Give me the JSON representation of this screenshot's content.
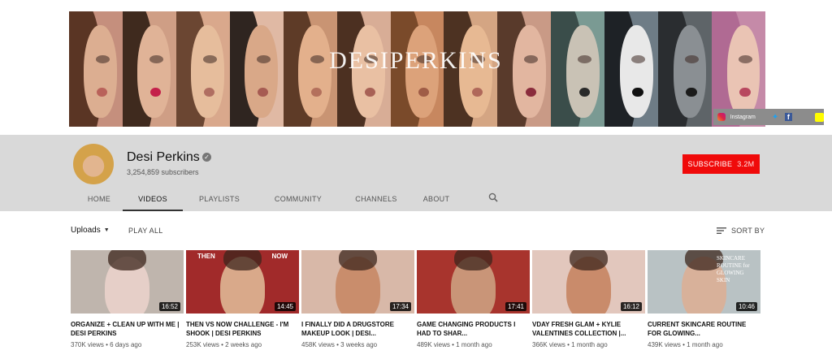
{
  "banner": {
    "title": "DESIPERKINS",
    "social": {
      "instagram_label": "Instagram"
    },
    "panel_colors": [
      {
        "bg": "#c58f7d",
        "hair": "#5a3524",
        "face": "#dcae91",
        "lips": "#b9625a"
      },
      {
        "bg": "#cf9e85",
        "hair": "#3f2a1e",
        "face": "#e0b397",
        "lips": "#c4204a"
      },
      {
        "bg": "#d9a88c",
        "hair": "#6b4632",
        "face": "#e6bd9c",
        "lips": "#b06e61"
      },
      {
        "bg": "#e0b9a4",
        "hair": "#2f2520",
        "face": "#d9a888",
        "lips": "#a65b52"
      },
      {
        "bg": "#c99473",
        "hair": "#5e3b27",
        "face": "#e3b08c",
        "lips": "#b4705c"
      },
      {
        "bg": "#d8ad96",
        "hair": "#4c3021",
        "face": "#e9c0a3",
        "lips": "#a86156"
      },
      {
        "bg": "#c7875f",
        "hair": "#7a4a2a",
        "face": "#dca27a",
        "lips": "#9f5c46"
      },
      {
        "bg": "#d4a583",
        "hair": "#4d3222",
        "face": "#e7b993",
        "lips": "#b0685a"
      },
      {
        "bg": "#c99a86",
        "hair": "#593a2b",
        "face": "#e2b6a0",
        "lips": "#8a2c3c"
      },
      {
        "bg": "#7a9a93",
        "hair": "#3a4d4a",
        "face": "#c9c2b5",
        "lips": "#2a2a2a"
      },
      {
        "bg": "#6e7c86",
        "hair": "#1e2226",
        "face": "#e8e8e8",
        "lips": "#111111"
      },
      {
        "bg": "#5e6468",
        "hair": "#2a2d30",
        "face": "#8a8f93",
        "lips": "#1b1b1b"
      },
      {
        "bg": "#c58aa8",
        "hair": "#b06a93",
        "face": "#eac4b4",
        "lips": "#b8485f"
      }
    ]
  },
  "channel": {
    "name": "Desi Perkins",
    "subscribers": "3,254,859 subscribers",
    "subscribe_label": "SUBSCRIBE",
    "subscribe_count": "3.2M",
    "tabs": [
      {
        "label": "HOME",
        "width": 58
      },
      {
        "label": "VIDEOS",
        "width": 74,
        "active": true
      },
      {
        "label": "PLAYLISTS",
        "width": 90
      },
      {
        "label": "COMMUNITY",
        "width": 104
      },
      {
        "label": "CHANNELS",
        "width": 88
      },
      {
        "label": "ABOUT",
        "width": 60
      }
    ]
  },
  "uploads": {
    "label": "Uploads",
    "play_all": "PLAY ALL",
    "sort_by": "SORT BY"
  },
  "videos": [
    {
      "title": "ORGANIZE + CLEAN UP WITH ME | DESI PERKINS",
      "views": "370K views",
      "age": "6 days ago",
      "duration": "16:52",
      "bg": "#bfb5ad",
      "fig": "#e6cfc8"
    },
    {
      "title": "THEN VS NOW CHALLENGE - I'M SHOOK | DESI PERKINS",
      "views": "253K views",
      "age": "2 weeks ago",
      "duration": "14:45",
      "bg": "#a12a2a",
      "fig": "#d9a98a",
      "label_left": "THEN",
      "label_right": "NOW"
    },
    {
      "title": "I FINALLY DID A DRUGSTORE MAKEUP LOOK | DESI...",
      "views": "458K views",
      "age": "3 weeks ago",
      "duration": "17:34",
      "bg": "#d8b8a8",
      "fig": "#c98d6c"
    },
    {
      "title": "GAME CHANGING PRODUCTS I HAD TO SHAR...",
      "views": "489K views",
      "age": "1 month ago",
      "duration": "17:41",
      "bg": "#a8342d",
      "fig": "#c99578"
    },
    {
      "title": "VDAY FRESH GLAM + KYLIE VALENTINES COLLECTION |...",
      "views": "366K views",
      "age": "1 month ago",
      "duration": "16:12",
      "bg": "#e2c7bd",
      "fig": "#c98b6b"
    },
    {
      "title": "CURRENT SKINCARE ROUTINE FOR GLOWING...",
      "views": "439K views",
      "age": "1 month ago",
      "duration": "10:46",
      "bg": "#b9c2c4",
      "fig": "#d8b19a",
      "label_right": "SKINCARE ROUTINE for GLOWING SKIN"
    }
  ]
}
